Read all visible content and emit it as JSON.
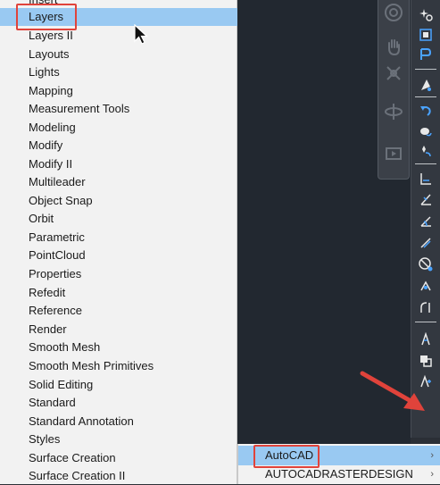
{
  "toolbar_menu": {
    "items": [
      "Insert",
      "Layers",
      "Layers II",
      "Layouts",
      "Lights",
      "Mapping",
      "Measurement Tools",
      "Modeling",
      "Modify",
      "Modify II",
      "Multileader",
      "Object Snap",
      "Orbit",
      "Parametric",
      "PointCloud",
      "Properties",
      "Refedit",
      "Reference",
      "Render",
      "Smooth Mesh",
      "Smooth Mesh Primitives",
      "Solid Editing",
      "Standard",
      "Standard Annotation",
      "Styles",
      "Surface Creation",
      "Surface Creation II"
    ],
    "highlighted": "Layers"
  },
  "submenu": {
    "items": [
      {
        "label": "AutoCAD",
        "has_submenu": true,
        "highlighted": true
      },
      {
        "label": "AUTOCADRASTERDESIGN",
        "has_submenu": true,
        "highlighted": false
      }
    ]
  },
  "colors": {
    "highlight": "#99c9f2",
    "annotation_red": "#e0433b",
    "canvas_bg": "#222830",
    "icon_blue": "#4aa3ff"
  }
}
